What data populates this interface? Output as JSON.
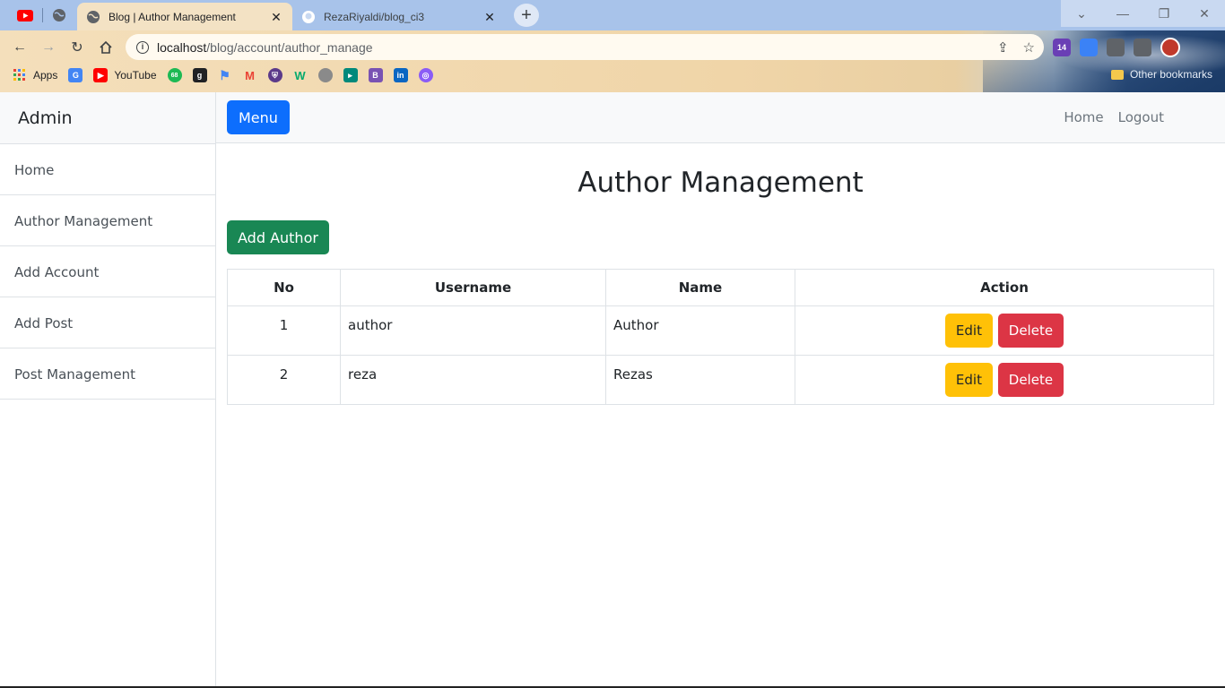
{
  "browser": {
    "tabs": [
      {
        "title": "Blog | Author Management",
        "active": true
      },
      {
        "title": "RezaRiyaldi/blog_ci3",
        "active": false
      }
    ],
    "url_host": "localhost",
    "url_path": "/blog/account/author_manage",
    "bookmarks": [
      {
        "label": "Apps",
        "icon": "apps-grid-icon"
      },
      {
        "label": "",
        "icon": "google-translate-icon"
      },
      {
        "label": "YouTube",
        "icon": "youtube-icon"
      },
      {
        "label": "",
        "icon": "badge-68-icon"
      },
      {
        "label": "",
        "icon": "bookmark-g-icon"
      },
      {
        "label": "",
        "icon": "flag-icon"
      },
      {
        "label": "",
        "icon": "gmail-icon"
      },
      {
        "label": "",
        "icon": "shield-icon"
      },
      {
        "label": "",
        "icon": "w3schools-icon"
      },
      {
        "label": "",
        "icon": "github-icon"
      },
      {
        "label": "",
        "icon": "meet-icon"
      },
      {
        "label": "",
        "icon": "bootstrap-icon"
      },
      {
        "label": "",
        "icon": "linkedin-icon"
      },
      {
        "label": "",
        "icon": "search-bubble-icon"
      }
    ],
    "other_bookmarks": "Other bookmarks",
    "extension_badge": "14",
    "badge_68": "68"
  },
  "sidebar": {
    "heading": "Admin",
    "items": [
      {
        "label": "Home"
      },
      {
        "label": "Author Management"
      },
      {
        "label": "Add Account"
      },
      {
        "label": "Add Post"
      },
      {
        "label": "Post Management"
      }
    ]
  },
  "topnav": {
    "menu_label": "Menu",
    "links": [
      {
        "label": "Home"
      },
      {
        "label": "Logout"
      }
    ]
  },
  "main": {
    "title": "Author Management",
    "add_button": "Add Author",
    "table": {
      "headers": [
        "No",
        "Username",
        "Name",
        "Action"
      ],
      "rows": [
        {
          "no": "1",
          "username": "author",
          "name": "Author"
        },
        {
          "no": "2",
          "username": "reza",
          "name": "Rezas"
        }
      ],
      "edit_label": "Edit",
      "delete_label": "Delete"
    }
  },
  "colors": {
    "primary": "#0d6efd",
    "success": "#198754",
    "warning": "#ffc107",
    "danger": "#dc3545"
  }
}
